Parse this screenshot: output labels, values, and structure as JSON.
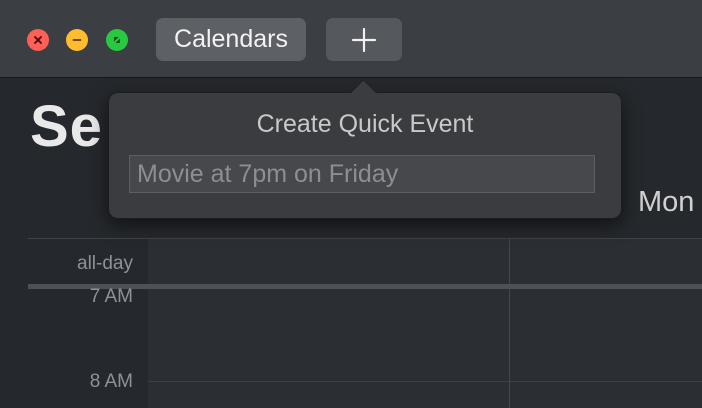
{
  "window": {
    "close_icon": "close-icon",
    "minimize_icon": "minimize-icon",
    "fullscreen_icon": "fullscreen-icon"
  },
  "toolbar": {
    "calendars_label": "Calendars",
    "add_icon": "plus-icon"
  },
  "calendar": {
    "title_partial": "Se",
    "day_header": "Mon",
    "all_day_label": "all-day",
    "time_labels": [
      "7 AM",
      "8 AM"
    ]
  },
  "quick_event": {
    "title": "Create Quick Event",
    "input_placeholder": "Movie at 7pm on Friday",
    "input_value": ""
  },
  "colors": {
    "close": "#fe5f57",
    "minimize": "#febc2e",
    "fullscreen": "#28c840"
  }
}
